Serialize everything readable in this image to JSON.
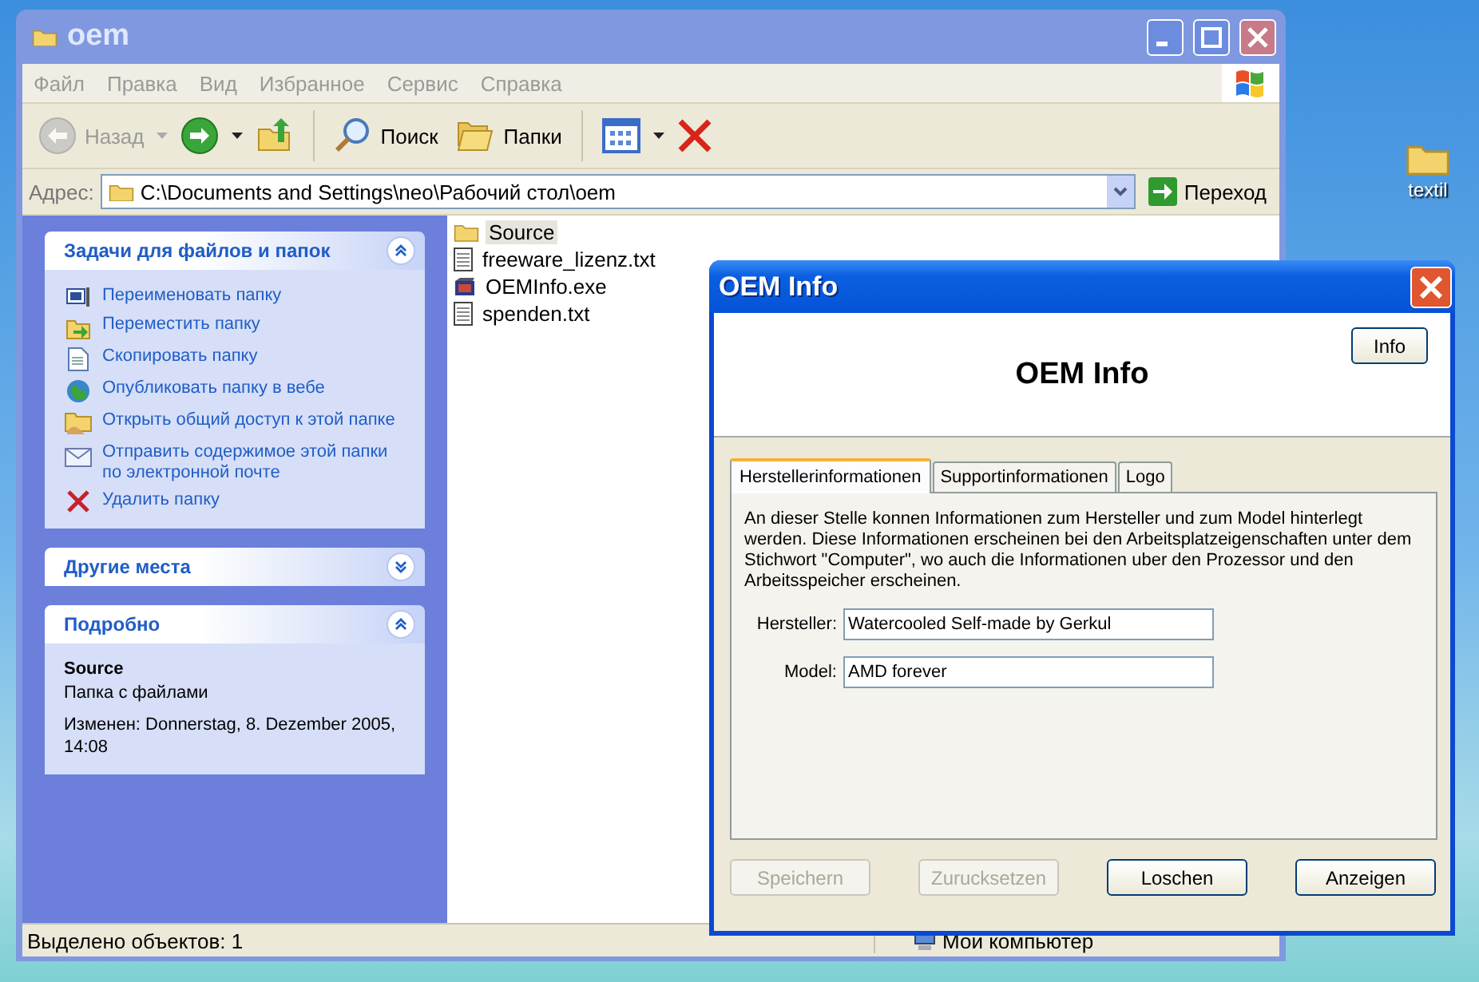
{
  "desktop": {
    "icons": [
      {
        "label": "textil"
      }
    ]
  },
  "explorer": {
    "title": "oem",
    "menu": [
      "Файл",
      "Правка",
      "Вид",
      "Избранное",
      "Сервис",
      "Справка"
    ],
    "toolbar": [
      {
        "kind": "back",
        "label": "Назад",
        "disabled": true
      },
      {
        "kind": "forward",
        "disabled": false
      },
      {
        "kind": "up",
        "disabled": false
      },
      {
        "kind": "search",
        "label": "Поиск",
        "disabled": false
      },
      {
        "kind": "folders",
        "label": "Папки",
        "disabled": false
      },
      {
        "kind": "views",
        "disabled": false
      },
      {
        "kind": "delete",
        "disabled": false
      }
    ],
    "address": {
      "label": "Адрес:",
      "value": "C:\\Documents and Settings\\neo\\Рабочий стол\\oem",
      "go": "Переход"
    },
    "sidebar": [
      {
        "kind": "tasks",
        "title": "Задачи для файлов и папок",
        "expanded": true,
        "items": [
          {
            "label": "Переименовать папку"
          },
          {
            "label": "Переместить папку"
          },
          {
            "label": "Скопировать папку"
          },
          {
            "label": "Опубликовать папку в вебе"
          },
          {
            "label": "Открыть общий доступ к этой папке"
          },
          {
            "label": "Отправить содержимое этой папки по электронной почте"
          },
          {
            "label": "Удалить папку"
          }
        ]
      },
      {
        "kind": "places",
        "title": "Другие места",
        "expanded": false
      },
      {
        "kind": "details",
        "title": "Подробно",
        "expanded": true,
        "name": "Source",
        "type": "Папка с файлами",
        "modified": "Изменен: Donnerstag, 8. Dezember 2005, 14:08"
      }
    ],
    "files": [
      {
        "kind": "folder",
        "name": "Source",
        "selected": true
      },
      {
        "kind": "text",
        "name": "freeware_lizenz.txt",
        "selected": false
      },
      {
        "kind": "exe",
        "name": "OEMInfo.exe",
        "selected": false
      },
      {
        "kind": "text",
        "name": "spenden.txt",
        "selected": false
      }
    ],
    "status_bar": {
      "selection": "Выделено объектов: 1",
      "location": "Мои компьютер"
    }
  },
  "dialog": {
    "title": "OEM Info",
    "heading": "OEM Info",
    "info_button": "Info",
    "tabs": [
      {
        "label": "Herstellerinformationen",
        "selected": true
      },
      {
        "label": "Supportinformationen",
        "selected": false
      },
      {
        "label": "Logo",
        "selected": false
      }
    ],
    "description": "An dieser Stelle konnen Informationen zum Hersteller und zum Model hinterlegt werden. Diese Informationen erscheinen bei den Arbeitsplatzeigenschaften unter dem Stichwort \"Computer\", wo auch die Informationen uber den Prozessor und den Arbeitsspeicher erscheinen.",
    "fields": [
      {
        "label": "Hersteller:",
        "value": "Watercooled Self-made by Gerkul"
      },
      {
        "label": "Model:",
        "value": "AMD forever"
      }
    ],
    "buttons": [
      {
        "label": "Speichern",
        "disabled": true
      },
      {
        "label": "Zurucksetzen",
        "disabled": true
      },
      {
        "label": "Loschen",
        "disabled": false
      },
      {
        "label": "Anzeigen",
        "disabled": false
      }
    ]
  }
}
